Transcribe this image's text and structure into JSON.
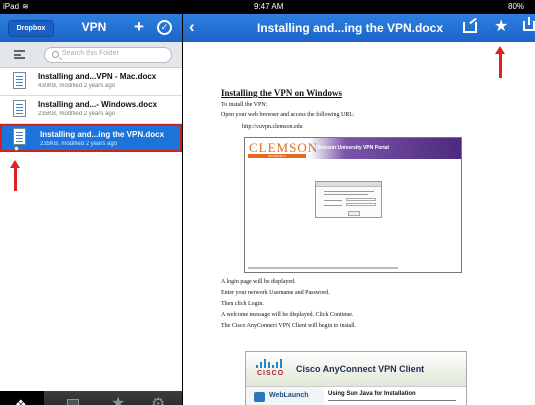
{
  "status": {
    "device": "iPad",
    "wifi_icon": "wifi-icon",
    "time": "9:47 AM",
    "battery": "80%"
  },
  "left_nav": {
    "back_label": "Dropbox",
    "title": "VPN",
    "add_icon": "plus-icon",
    "select_icon": "checkmark-circle-icon"
  },
  "search": {
    "placeholder": "Search this Folder"
  },
  "files": [
    {
      "name": "Installing and...VPN - Mac.docx",
      "meta": "430KB, modified 2 years ago"
    },
    {
      "name": "Installing and...- Windows.docx",
      "meta": "235KB, modified 2 years ago"
    },
    {
      "name": "Installing and...ing the VPN.docx",
      "meta": "235KB, modified 2 years ago",
      "selected": true
    }
  ],
  "bottom_tabs": [
    "dropbox-icon",
    "photos-icon",
    "star-icon",
    "gear-icon"
  ],
  "doc_nav": {
    "title": "Installing and...ing the VPN.docx",
    "actions": [
      "share-icon",
      "star-icon",
      "download-icon"
    ]
  },
  "document": {
    "heading": "Installing the VPN on Windows",
    "intro": "To install the VPN:",
    "open_line": "Open your web browser and access the following URL:",
    "url": "http://cuvpn.clemson.edu",
    "lines": [
      "A login page will be displayed.",
      "Enter your network Username and Password.",
      "Then click Login.",
      "A welcome message will be displayed.  Click Continue.",
      "The Cisco AnyConnect VPN Client will begin to install."
    ]
  },
  "screenshot1": {
    "logo": "CLEMSON",
    "logo_sub": "UNIVERSITY",
    "portal_title": "Clemson University VPN Portal"
  },
  "screenshot2": {
    "logo": "CISCO",
    "title": "Cisco AnyConnect VPN Client",
    "side_label": "WebLaunch",
    "step_label": "Using Sun Java for Installation"
  }
}
